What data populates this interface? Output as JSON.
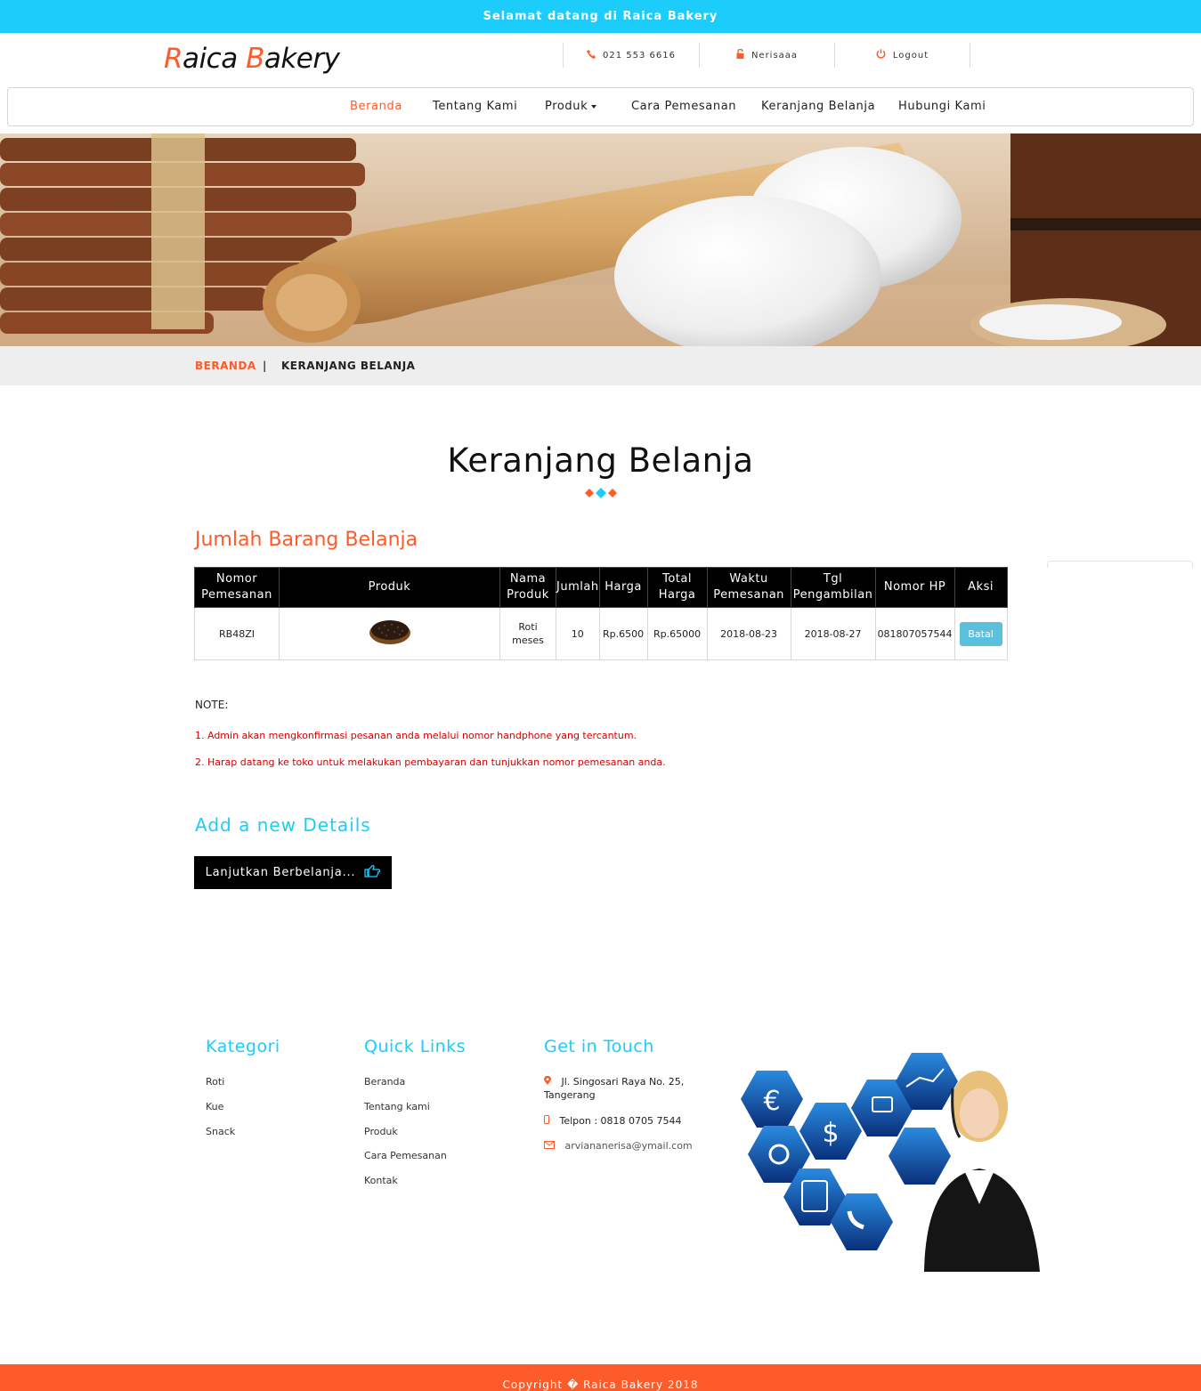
{
  "topbar": {
    "welcome_text": "Selamat datang di Raica Bakery"
  },
  "brand": {
    "first_initial": "R",
    "first_rest": "aica",
    "second_initial": "B",
    "second_rest": "akery",
    "accent_color": "#fd5b2a"
  },
  "header": {
    "phone": "021 553 6616",
    "username": "Nerisaaa",
    "logout_label": "Logout"
  },
  "nav": {
    "beranda": "Beranda",
    "tentang": "Tentang Kami",
    "produk": "Produk",
    "cara": "Cara Pemesanan",
    "keranjang": "Keranjang Belanja",
    "hubungi": "Hubungi Kami"
  },
  "breadcrumb": {
    "home": "BERANDA",
    "separator": "|",
    "current": "KERANJANG BELANJA"
  },
  "page": {
    "title": "Keranjang Belanja",
    "section_title": "Jumlah Barang Belanja"
  },
  "table": {
    "headers": {
      "nomor_1": "Nomor",
      "nomor_2": "Pemesanan",
      "produk": "Produk",
      "nama_1": "Nama",
      "nama_2": "Produk",
      "jumlah": "Jumlah",
      "harga": "Harga",
      "total_1": "Total",
      "total_2": "Harga",
      "waktu_1": "Waktu",
      "waktu_2": "Pemesanan",
      "tgl_1": "Tgl",
      "tgl_2": "Pengambilan",
      "hp": "Nomor HP",
      "aksi": "Aksi"
    },
    "rows": [
      {
        "nomor": "RB48ZI",
        "nama_1": "Roti",
        "nama_2": "meses",
        "jumlah": "10",
        "harga": "Rp.6500",
        "total": "Rp.65000",
        "waktu": "2018-08-23",
        "tgl": "2018-08-27",
        "hp": "081807057544",
        "aksi": "Batal"
      }
    ]
  },
  "note": {
    "label": "NOTE:",
    "line1": "1. Admin akan mengkonfirmasi pesanan anda melalui nomor handphone yang tercantum.",
    "line2": "2. Harap datang ke toko untuk melakukan pembayaran dan tunjukkan nomor pemesanan anda."
  },
  "add_section": {
    "title": "Add a new Details",
    "continue_label": "Lanjutkan Berbelanja..."
  },
  "footer": {
    "kategori": {
      "title": "Kategori",
      "items": [
        "Roti",
        "Kue",
        "Snack"
      ]
    },
    "quick_links": {
      "title": "Quick Links",
      "items": [
        "Beranda",
        "Tentang kami",
        "Produk",
        "Cara Pemesanan",
        "Kontak"
      ]
    },
    "touch": {
      "title": "Get in Touch",
      "address_1": "Jl. Singosari Raya No. 25,",
      "address_2": "Tangerang",
      "phone": "Telpon : 0818 0705 7544",
      "email": "arviananerisa@ymail.com"
    }
  },
  "copyright": "Copyright � Raica Bakery 2018",
  "icons": [
    "phone-icon",
    "lock-icon",
    "power-icon",
    "caret-down-icon",
    "hand-pointer-icon",
    "map-marker-icon",
    "mobile-icon",
    "envelope-icon"
  ],
  "colors": {
    "cyan": "#1ccdfc",
    "orange": "#fd5b2a",
    "black": "#000000",
    "batal": "#5bc0de"
  }
}
